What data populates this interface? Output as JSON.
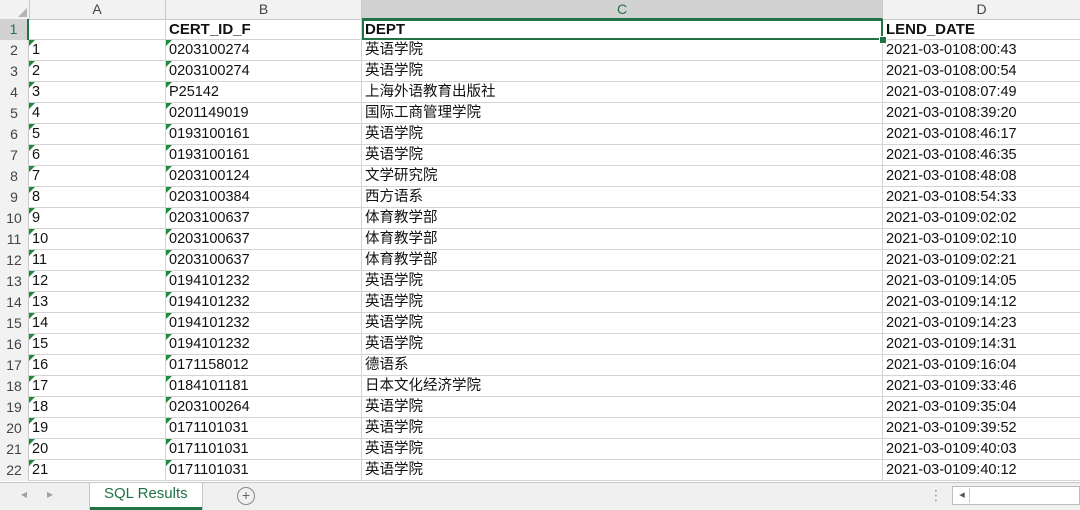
{
  "sheet": {
    "columns": [
      {
        "letter": "A"
      },
      {
        "letter": "B"
      },
      {
        "letter": "C"
      },
      {
        "letter": "D"
      }
    ],
    "header_row": {
      "num": "1",
      "a": "",
      "b": "CERT_ID_F",
      "c": "DEPT",
      "d": "LEND_DATE"
    },
    "rows": [
      {
        "num": "2",
        "a": "1",
        "b": "0203100274",
        "c": "英语学院",
        "d": "2021-03-0108:00:43"
      },
      {
        "num": "3",
        "a": "2",
        "b": "0203100274",
        "c": "英语学院",
        "d": "2021-03-0108:00:54"
      },
      {
        "num": "4",
        "a": "3",
        "b": "P25142",
        "c": "上海外语教育出版社",
        "d": "2021-03-0108:07:49"
      },
      {
        "num": "5",
        "a": "4",
        "b": "0201149019",
        "c": "国际工商管理学院",
        "d": "2021-03-0108:39:20"
      },
      {
        "num": "6",
        "a": "5",
        "b": "0193100161",
        "c": "英语学院",
        "d": "2021-03-0108:46:17"
      },
      {
        "num": "7",
        "a": "6",
        "b": "0193100161",
        "c": "英语学院",
        "d": "2021-03-0108:46:35"
      },
      {
        "num": "8",
        "a": "7",
        "b": "0203100124",
        "c": "文学研究院",
        "d": "2021-03-0108:48:08"
      },
      {
        "num": "9",
        "a": "8",
        "b": "0203100384",
        "c": "西方语系",
        "d": "2021-03-0108:54:33"
      },
      {
        "num": "10",
        "a": "9",
        "b": "0203100637",
        "c": "体育教学部",
        "d": "2021-03-0109:02:02"
      },
      {
        "num": "11",
        "a": "10",
        "b": "0203100637",
        "c": "体育教学部",
        "d": "2021-03-0109:02:10"
      },
      {
        "num": "12",
        "a": "11",
        "b": "0203100637",
        "c": "体育教学部",
        "d": "2021-03-0109:02:21"
      },
      {
        "num": "13",
        "a": "12",
        "b": "0194101232",
        "c": "英语学院",
        "d": "2021-03-0109:14:05"
      },
      {
        "num": "14",
        "a": "13",
        "b": "0194101232",
        "c": "英语学院",
        "d": "2021-03-0109:14:12"
      },
      {
        "num": "15",
        "a": "14",
        "b": "0194101232",
        "c": "英语学院",
        "d": "2021-03-0109:14:23"
      },
      {
        "num": "16",
        "a": "15",
        "b": "0194101232",
        "c": "英语学院",
        "d": "2021-03-0109:14:31"
      },
      {
        "num": "17",
        "a": "16",
        "b": "0171158012",
        "c": "德语系",
        "d": "2021-03-0109:16:04"
      },
      {
        "num": "18",
        "a": "17",
        "b": "0184101181",
        "c": "日本文化经济学院",
        "d": "2021-03-0109:33:46"
      },
      {
        "num": "19",
        "a": "18",
        "b": "0203100264",
        "c": "英语学院",
        "d": "2021-03-0109:35:04"
      },
      {
        "num": "20",
        "a": "19",
        "b": "0171101031",
        "c": "英语学院",
        "d": "2021-03-0109:39:52"
      },
      {
        "num": "21",
        "a": "20",
        "b": "0171101031",
        "c": "英语学院",
        "d": "2021-03-0109:40:03"
      },
      {
        "num": "22",
        "a": "21",
        "b": "0171101031",
        "c": "英语学院",
        "d": "2021-03-0109:40:12"
      }
    ]
  },
  "tabs": {
    "sheet_tab": "SQL Results",
    "add_glyph": "+",
    "nav_prev": "◂",
    "nav_next": "▸",
    "scroll_left_glyph": "◂",
    "dots": "⋮"
  },
  "colors": {
    "accent": "#217346",
    "error_triangle": "#1e8a3c"
  }
}
